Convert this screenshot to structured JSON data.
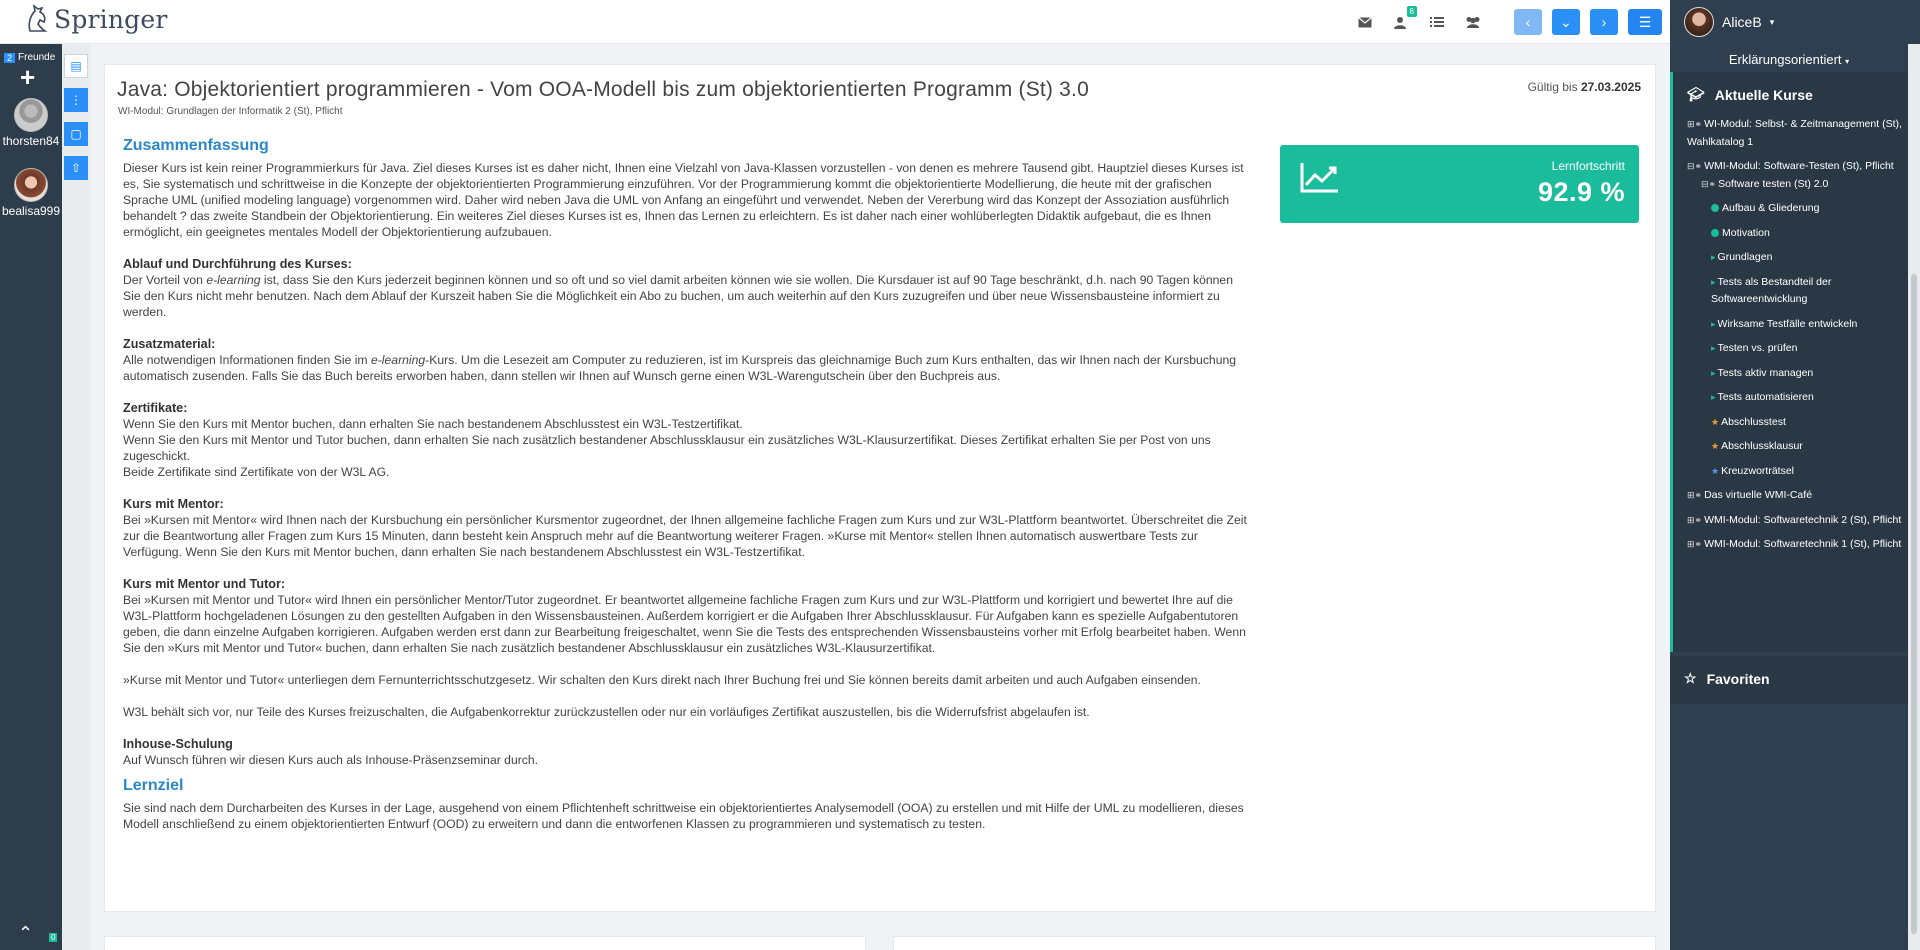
{
  "header": {
    "logo_text": "Springer",
    "mail_badge": "",
    "contacts_badge": "8",
    "user_name": "AliceB"
  },
  "left_rail": {
    "friends_count": "2",
    "friends_label": "Freunde",
    "friends": [
      {
        "name": "thorsten84"
      },
      {
        "name": "bealisa999"
      }
    ],
    "messages_badge": "0"
  },
  "course": {
    "title": "Java: Objektorientiert programmieren - Vom OOA-Modell bis zum objektorientierten Programm (St) 3.0",
    "subtitle": "WI-Modul: Grundlagen der Informatik 2 (St), Pflicht",
    "valid_label": "Gültig bis",
    "valid_date": "27.03.2025",
    "progress_label": "Lernfortschritt",
    "progress_value": "92.9 %",
    "summary_heading": "Zusammenfassung",
    "summary_text": "Dieser Kurs ist kein reiner Programmierkurs für Java. Ziel dieses Kurses ist es daher nicht, Ihnen eine Vielzahl von Java-Klassen vorzustellen - von denen es mehrere Tausend gibt. Hauptziel dieses Kurses ist es, Sie systematisch und schrittweise in die Konzepte der objektorientierten Programmierung einzuführen. Vor der Programmierung kommt die objektorientierte Modellierung, die heute mit der grafischen Sprache UML (unified modeling language) vorgenommen wird. Daher wird neben Java die UML von Anfang an eingeführt und verwendet. Neben der Vererbung wird das Konzept der Assoziation ausführlich behandelt ? das zweite Standbein der Objektorientierung. Ein weiteres Ziel dieses Kurses ist es, Ihnen das Lernen zu erleichtern. Es ist daher nach einer wohlüberlegten Didaktik aufgebaut, die es Ihnen ermöglicht, ein geeignetes mentales Modell der Objektorientierung aufzubauen.",
    "ablauf_heading": "Ablauf und Durchführung des Kurses:",
    "ablauf_text_pre": "Der Vorteil von ",
    "ablauf_em": "e-learning",
    "ablauf_text_post": " ist, dass Sie den Kurs jederzeit beginnen können und so oft und so viel damit arbeiten können wie sie wollen. Die Kursdauer ist auf 90 Tage beschränkt, d.h. nach 90 Tagen können Sie den Kurs nicht mehr benutzen. Nach dem Ablauf der Kurszeit haben Sie die Möglichkeit ein Abo zu buchen, um auch weiterhin auf den Kurs zuzugreifen und über neue Wissensbausteine informiert zu werden.",
    "zusatz_heading": "Zusatzmaterial:",
    "zusatz_text_pre": "Alle notwendigen Informationen finden Sie im ",
    "zusatz_em": "e-learning",
    "zusatz_text_post": "-Kurs. Um die Lesezeit am Computer zu reduzieren, ist im Kurspreis das gleichnamige Buch zum Kurs enthalten, das wir Ihnen nach der Kursbuchung automatisch zusenden. Falls Sie das Buch bereits erworben haben, dann stellen wir Ihnen auf Wunsch gerne einen W3L-Warengutschein über den Buchpreis aus.",
    "zert_heading": "Zertifikate:",
    "zert_lines": [
      "Wenn Sie den Kurs mit Mentor buchen, dann erhalten Sie nach bestandenem Abschlusstest ein W3L-Testzertifikat.",
      "Wenn Sie den Kurs mit Mentor und Tutor buchen, dann erhalten Sie nach zusätzlich bestandener Abschlussklausur ein zusätzliches W3L-Klausurzertifikat. Dieses Zertifikat erhalten Sie per Post von uns zugeschickt.",
      "Beide Zertifikate sind Zertifikate von der W3L AG."
    ],
    "mentor_heading": "Kurs mit Mentor:",
    "mentor_text": "Bei »Kursen mit Mentor« wird Ihnen nach der Kursbuchung ein persönlicher Kursmentor zugeordnet, der Ihnen allgemeine fachliche Fragen zum Kurs und zur W3L-Plattform beantwortet. Überschreitet die Zeit zur die Beantwortung aller Fragen zum Kurs 15 Minuten, dann besteht kein Anspruch mehr auf die Beantwortung weiterer Fragen. »Kurse mit Mentor« stellen Ihnen automatisch auswertbare Tests zur Verfügung. Wenn Sie den Kurs mit Mentor buchen, dann erhalten Sie nach bestandenem Abschlusstest ein W3L-Testzertifikat.",
    "tutor_heading": "Kurs mit Mentor und Tutor:",
    "tutor_text": "Bei »Kursen mit Mentor und Tutor« wird Ihnen ein persönlicher Mentor/Tutor zugeordnet. Er beantwortet allgemeine fachliche Fragen zum Kurs und zur W3L-Plattform und korrigiert und bewertet Ihre auf die W3L-Plattform hochgeladenen Lösungen zu den gestellten Aufgaben in den Wissensbausteinen. Außerdem korrigiert er die Aufgaben Ihrer Abschlussklausur. Für Aufgaben kann es spezielle Aufgabentutoren geben, die dann einzelne Aufgaben korrigieren. Aufgaben werden erst dann zur Bearbeitung freigeschaltet, wenn Sie die Tests des entsprechenden Wissensbausteins vorher mit Erfolg bearbeitet haben. Wenn Sie den »Kurs mit Mentor und Tutor« buchen, dann erhalten Sie nach zusätzlich bestandener Abschlussklausur ein zusätzliches W3L-Klausurzertifikat.",
    "fernunterricht_text": "»Kurse mit Mentor und Tutor« unterliegen dem Fernunterrichtsschutzgesetz. Wir schalten den Kurs direkt nach Ihrer Buchung frei und Sie können bereits damit arbeiten und auch Aufgaben einsenden.",
    "vorbehalt_text": "W3L behält sich vor, nur Teile des Kurses freizuschalten, die Aufgabenkorrektur zurückzustellen oder nur ein vorläufiges Zertifikat auszustellen, bis die Widerrufsfrist abgelaufen ist.",
    "inhouse_heading": "Inhouse-Schulung",
    "inhouse_text": "Auf Wunsch führen wir diesen Kurs auch als Inhouse-Präsenzseminar durch.",
    "lernziel_heading": "Lernziel",
    "lernziel_text": "Sie sind nach dem Durcharbeiten des Kurses in der Lage, ausgehend von einem Pflichtenheft schrittweise ein objektorientiertes Analysemodell (OOA) zu erstellen und mit Hilfe der UML zu modellieren, dieses Modell anschließend zu einem objektorientierten Entwurf (OOD) zu erweitern und dann die entworfenen Klassen zu programmieren und systematisch zu testen."
  },
  "sidebar": {
    "mode_label": "Erklärungsorientiert",
    "courses_heading": "Aktuelle Kurse",
    "favorites_heading": "Favoriten",
    "tree": [
      {
        "prefix": "⊞",
        "label": "WI-Modul: Selbst- & Zeitmanagement (St), Wahlkatalog 1"
      },
      {
        "prefix": "⊟",
        "label": "WMI-Modul: Software-Testen (St), Pflicht"
      },
      {
        "prefix": "⊟",
        "label": "Software testen (St) 2.0"
      },
      {
        "prefix": "dot",
        "label": "Aufbau & Gliederung"
      },
      {
        "prefix": "dot",
        "label": "Motivation"
      },
      {
        "prefix": "arrow",
        "label": "Grundlagen"
      },
      {
        "prefix": "arrow",
        "label": "Tests als Bestandteil der Softwareentwicklung"
      },
      {
        "prefix": "arrow",
        "label": "Wirksame Testfälle entwickeln"
      },
      {
        "prefix": "arrow",
        "label": "Testen vs. prüfen"
      },
      {
        "prefix": "arrow",
        "label": "Tests aktiv managen"
      },
      {
        "prefix": "arrow",
        "label": "Tests automatisieren"
      },
      {
        "prefix": "star-orange",
        "label": "Abschlusstest"
      },
      {
        "prefix": "star-orange",
        "label": "Abschlussklausur"
      },
      {
        "prefix": "star-blue",
        "label": "Kreuzworträtsel"
      },
      {
        "prefix": "⊞",
        "label": "Das virtuelle WMI-Café"
      },
      {
        "prefix": "⊞",
        "label": "WMI-Modul: Softwaretechnik 2 (St), Pflicht"
      },
      {
        "prefix": "⊞",
        "label": "WMI-Modul: Softwaretechnik 1 (St), Pflicht"
      }
    ]
  },
  "colors": {
    "accent": "#2a8ff7",
    "teal": "#1abc9c",
    "sidebar_bg": "#2f3f4f",
    "heading_blue": "#2a88c8"
  }
}
